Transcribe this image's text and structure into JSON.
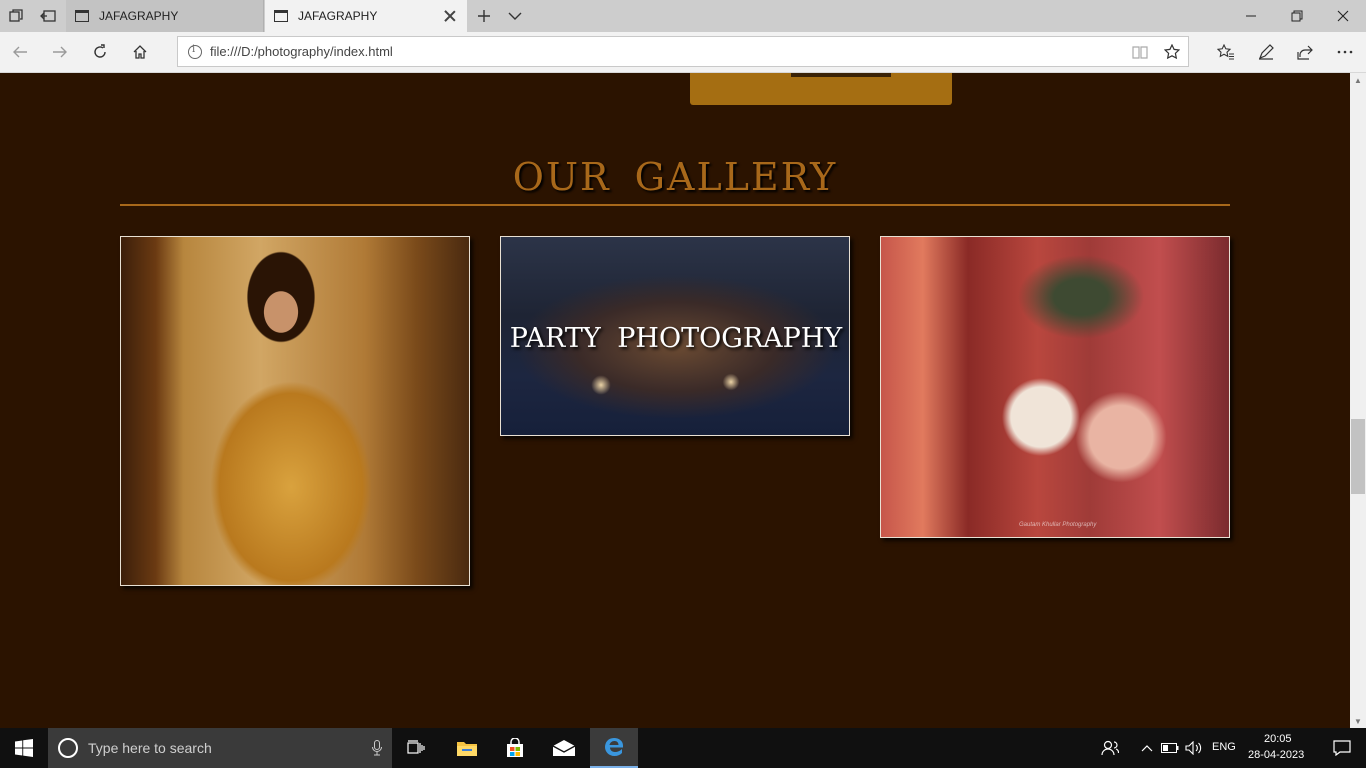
{
  "browser": {
    "tabs": [
      {
        "title": "JAFAGRAPHY",
        "active": false
      },
      {
        "title": "JAFAGRAPHY",
        "active": true
      }
    ],
    "url": "file:///D:/photography/index.html"
  },
  "page": {
    "section_title": "OUR  GALLERY",
    "cards": [
      {
        "caption": ""
      },
      {
        "caption": "PARTY  PHOTOGRAPHY"
      },
      {
        "caption": ""
      }
    ],
    "watermark": "Gautam Khullar Photography"
  },
  "taskbar": {
    "search_placeholder": "Type here to search",
    "language": "ENG",
    "time": "20:05",
    "date": "28-04-2023"
  },
  "colors": {
    "page_background": "#2b1300",
    "accent_gold": "#a8681a",
    "button_gold": "#a56e12"
  }
}
